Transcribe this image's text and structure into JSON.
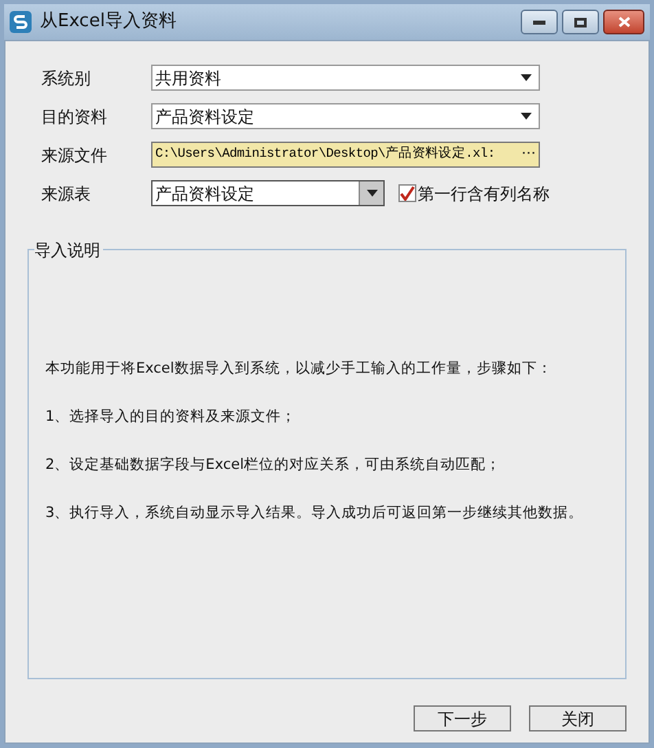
{
  "window": {
    "title": "从Excel导入资料"
  },
  "fields": [
    {
      "label": "系统别",
      "kind": "select",
      "value": "共用资料"
    },
    {
      "label": "目的资料",
      "kind": "select",
      "value": "产品资料设定"
    },
    {
      "label": "来源文件",
      "kind": "file",
      "value": "C:\\Users\\Administrator\\Desktop\\产品资料设定.xl:",
      "button": "···"
    },
    {
      "label": "来源表",
      "kind": "short-select",
      "value": "产品资料设定"
    }
  ],
  "header_checkbox": {
    "label": "第一行含有列名称",
    "checked": true
  },
  "instructions": {
    "title": "导入说明",
    "lines": [
      "本功能用于将Excel数据导入到系统，以减少手工输入的工作量，步骤如下：",
      "1、选择导入的目的资料及来源文件；",
      "2、设定基础数据字段与Excel栏位的对应关系，可由系统自动匹配；",
      "3、执行导入，系统自动显示导入结果。导入成功后可返回第一步继续其他数据。"
    ]
  },
  "buttons": [
    "下一步",
    "关闭"
  ]
}
